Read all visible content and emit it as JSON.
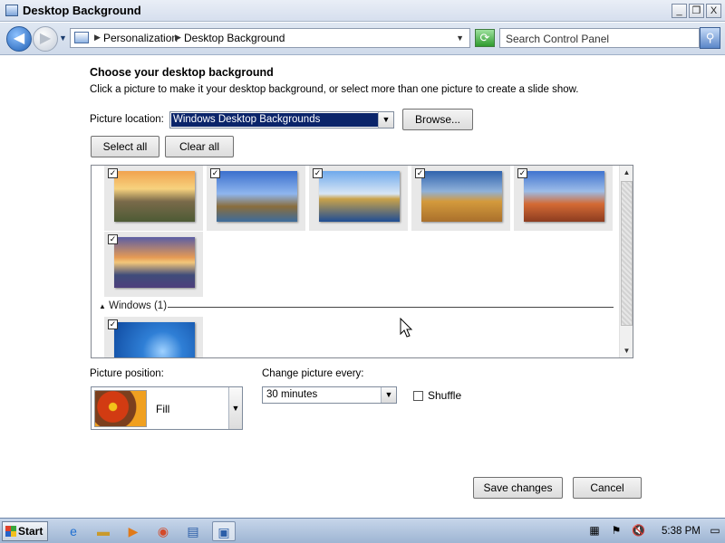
{
  "window": {
    "title": "Desktop Background",
    "controls": {
      "minimize": "_",
      "restore": "❐",
      "close": "X"
    }
  },
  "address_bar": {
    "breadcrumb": [
      "Personalization",
      "Desktop Background"
    ],
    "search_placeholder": "Search Control Panel"
  },
  "main": {
    "heading": "Choose your desktop background",
    "subheading": "Click a picture to make it your desktop background, or select more than one picture to create a slide show.",
    "picture_location_label": "Picture location:",
    "picture_location_value": "Windows Desktop Backgrounds",
    "browse_label": "Browse...",
    "select_all_label": "Select all",
    "clear_all_label": "Clear all",
    "gallery": {
      "items": [
        {
          "name": "sunset-meadow",
          "checked": true,
          "colors": [
            "#e89a4a",
            "#6a6f4a"
          ]
        },
        {
          "name": "lighthouse",
          "checked": true,
          "colors": [
            "#3f72c9",
            "#8b6a3a"
          ]
        },
        {
          "name": "sea-arch",
          "checked": true,
          "colors": [
            "#6fa8e8",
            "#1d4f97"
          ]
        },
        {
          "name": "hay-bale",
          "checked": true,
          "colors": [
            "#3d6fb5",
            "#c7872e"
          ]
        },
        {
          "name": "desert-arch",
          "checked": true,
          "colors": [
            "#4d7fd1",
            "#c2572c"
          ]
        },
        {
          "name": "lake-flowers",
          "checked": true,
          "colors": [
            "#e79a54",
            "#5a5fa8"
          ]
        }
      ],
      "group_label": "Windows (1)",
      "windows_item": {
        "name": "windows-7-default",
        "checked": true
      }
    },
    "picture_position_label": "Picture position:",
    "picture_position_value": "Fill",
    "change_every_label": "Change picture every:",
    "change_every_value": "30 minutes",
    "shuffle_label": "Shuffle",
    "shuffle_checked": false,
    "save_label": "Save changes",
    "cancel_label": "Cancel"
  },
  "taskbar": {
    "start_label": "Start",
    "clock": "5:38 PM"
  },
  "colors": {
    "selection": "#0a246a",
    "titlebar": "#dbe4f1"
  }
}
